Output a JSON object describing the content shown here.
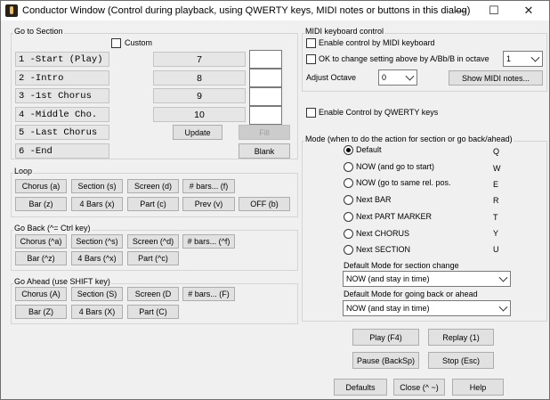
{
  "window": {
    "title": "Conductor Window (Control during playback, using QWERTY keys, MIDI notes or buttons in this dialog)",
    "minimize": "—",
    "maximize": "☐",
    "close": "✕"
  },
  "goto": {
    "label": "Go to Section",
    "custom_label": "Custom",
    "custom_checked": false,
    "sections": [
      "1 -Start (Play)",
      "2 -Intro",
      "3 -1st Chorus",
      "4 -Middle Cho.",
      "5 -Last Chorus",
      "6 -End"
    ],
    "bars": [
      "7",
      "8",
      "9",
      "10"
    ],
    "update": "Update",
    "fill": "Fill",
    "blank": "Blank"
  },
  "loop": {
    "label": "Loop",
    "row1": [
      "Chorus (a)",
      "Section (s)",
      "Screen (d)",
      "# bars... (f)"
    ],
    "row2": [
      "Bar (z)",
      "4 Bars (x)",
      "Part (c)",
      "Prev (v)",
      "OFF (b)"
    ]
  },
  "goback": {
    "label": "Go Back  (^= Ctrl key)",
    "row1": [
      "Chorus (^a)",
      "Section (^s)",
      "Screen (^d)",
      "# bars... (^f)"
    ],
    "row2": [
      "Bar (^z)",
      "4 Bars (^x)",
      "Part (^c)"
    ]
  },
  "goahead": {
    "label": "Go Ahead  (use SHIFT key)",
    "row1": [
      "Chorus (A)",
      "Section (S)",
      "Screen (D",
      "# bars... (F)"
    ],
    "row2": [
      "Bar (Z)",
      "4 Bars (X)",
      "Part (C)"
    ]
  },
  "midi": {
    "label": "MIDI keyboard control",
    "enable_label": "Enable control by MIDI keyboard",
    "enable_checked": false,
    "ok_label": "OK to change setting above by  A/Bb/B in octave",
    "ok_checked": false,
    "octave_value": "1",
    "adjust_label": "Adjust Octave",
    "adjust_value": "0",
    "show_notes": "Show MIDI notes..."
  },
  "qwerty": {
    "label": "Enable Control by QWERTY keys",
    "checked": false
  },
  "mode": {
    "label": "Mode (when to do the action for section or go back/ahead)",
    "options": [
      {
        "label": "Default",
        "key": "Q",
        "selected": true
      },
      {
        "label": "NOW (and go to start)",
        "key": "W",
        "selected": false
      },
      {
        "label": "NOW (go to same rel. pos.",
        "key": "E",
        "selected": false
      },
      {
        "label": "Next BAR",
        "key": "R",
        "selected": false
      },
      {
        "label": "Next PART MARKER",
        "key": "T",
        "selected": false
      },
      {
        "label": "Next CHORUS",
        "key": "Y",
        "selected": false
      },
      {
        "label": "Next SECTION",
        "key": "U",
        "selected": false
      }
    ],
    "section_change_label": "Default Mode for section change",
    "section_change_value": "NOW (and stay in time)",
    "back_ahead_label": "Default Mode for going back or ahead",
    "back_ahead_value": "NOW (and stay in time)"
  },
  "transport": {
    "play": "Play (F4)",
    "replay": "Replay (1)",
    "pause": "Pause (BackSp)",
    "stop": "Stop (Esc)"
  },
  "footer": {
    "defaults": "Defaults",
    "close": "Close (^ ~)",
    "help": "Help"
  }
}
